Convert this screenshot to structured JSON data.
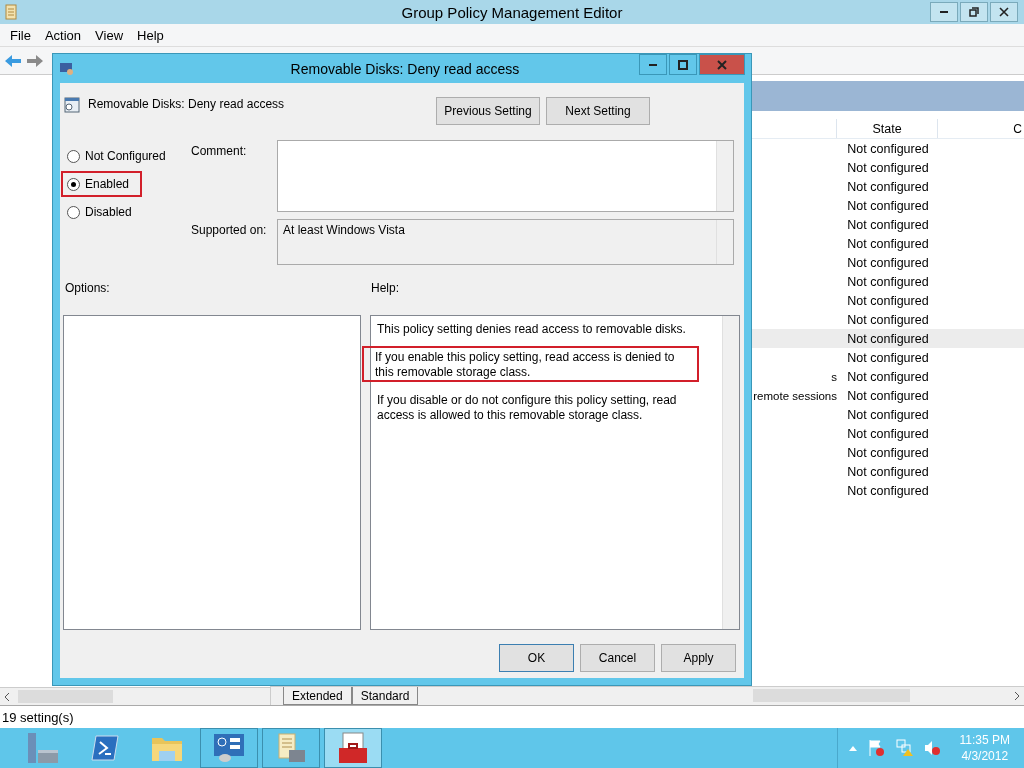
{
  "window": {
    "title": "Group Policy Management Editor"
  },
  "menu": [
    "File",
    "Action",
    "View",
    "Help"
  ],
  "settings_list": {
    "columns": [
      "State",
      "C"
    ],
    "rows": [
      {
        "state": "Not configured",
        "selected": false
      },
      {
        "state": "Not configured",
        "selected": false
      },
      {
        "state": "Not configured",
        "selected": false
      },
      {
        "state": "Not configured",
        "selected": false
      },
      {
        "state": "Not configured",
        "selected": false
      },
      {
        "state": "Not configured",
        "selected": false
      },
      {
        "state": "Not configured",
        "selected": false
      },
      {
        "state": "Not configured",
        "selected": false
      },
      {
        "state": "Not configured",
        "selected": false
      },
      {
        "state": "Not configured",
        "selected": false
      },
      {
        "state": "Not configured",
        "selected": true
      },
      {
        "state": "Not configured",
        "selected": false
      },
      {
        "name": "s",
        "state": "Not configured",
        "selected": false
      },
      {
        "name": "remote sessions",
        "state": "Not configured",
        "selected": false
      },
      {
        "state": "Not configured",
        "selected": false
      },
      {
        "state": "Not configured",
        "selected": false
      },
      {
        "state": "Not configured",
        "selected": false
      },
      {
        "state": "Not configured",
        "selected": false
      },
      {
        "state": "Not configured",
        "selected": false
      }
    ]
  },
  "view_tabs": [
    "Extended",
    "Standard"
  ],
  "status_bar": "19 setting(s)",
  "dialog": {
    "title": "Removable Disks: Deny read access",
    "setting_name": "Removable Disks: Deny read access",
    "nav_buttons": [
      "Previous Setting",
      "Next Setting"
    ],
    "options": [
      {
        "label": "Not Configured",
        "selected": false,
        "highlighted": false
      },
      {
        "label": "Enabled",
        "selected": true,
        "highlighted": true
      },
      {
        "label": "Disabled",
        "selected": false,
        "highlighted": false
      }
    ],
    "comment_label": "Comment:",
    "supported_label": "Supported on:",
    "supported_value": "At least Windows Vista",
    "options_label": "Options:",
    "help_label": "Help:",
    "help": [
      {
        "text": "This policy setting denies read access to removable disks.",
        "highlighted": false
      },
      {
        "text": "If you enable this policy setting, read access is denied to this removable storage class.",
        "highlighted": true
      },
      {
        "text": "If you disable or do not configure this policy setting, read access is allowed to this removable storage class.",
        "highlighted": false
      }
    ],
    "buttons": [
      "OK",
      "Cancel",
      "Apply"
    ]
  },
  "taskbar": {
    "apps": [
      {
        "kind": "server",
        "open": false,
        "selected": false
      },
      {
        "kind": "shell",
        "open": false,
        "selected": false
      },
      {
        "kind": "folder",
        "open": false,
        "selected": false
      },
      {
        "kind": "panel",
        "open": true,
        "selected": false
      },
      {
        "kind": "scroll",
        "open": true,
        "selected": false
      },
      {
        "kind": "toolbox",
        "open": true,
        "selected": true
      }
    ],
    "time": "11:35 PM",
    "date": "4/3/2012"
  }
}
